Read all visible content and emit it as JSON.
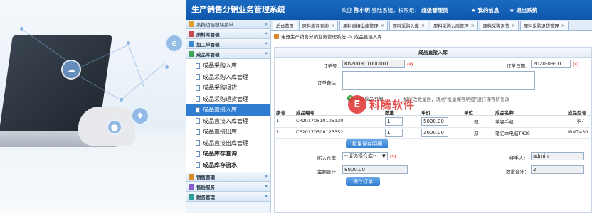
{
  "app": {
    "title": "生产销售分销业务管理系统",
    "welcome_prefix": "欢迎",
    "user": "陈小明",
    "welcome_mid": "登陆系统，权限组：",
    "role": "超级管理员",
    "my_info": "我的信息",
    "logout": "退出系统"
  },
  "sidebar": {
    "header": "系统功能模块菜单",
    "collapse_glyph": "«",
    "groups": [
      {
        "label": "原料库管理"
      },
      {
        "label": "加工单管理"
      },
      {
        "label": "成品库管理"
      }
    ],
    "items": [
      {
        "label": "成品采购入库"
      },
      {
        "label": "成品采购入库管理"
      },
      {
        "label": "成品采购退货"
      },
      {
        "label": "成品采购退货管理"
      },
      {
        "label": "成品直接入库"
      },
      {
        "label": "成品直接入库管理"
      },
      {
        "label": "成品直接出库"
      },
      {
        "label": "成品直接出库管理"
      },
      {
        "label": "成品库存查询"
      },
      {
        "label": "成品库存流水"
      }
    ],
    "bottom_groups": [
      {
        "label": "销售管理"
      },
      {
        "label": "售后服务"
      },
      {
        "label": "财务管理"
      }
    ]
  },
  "tabs": [
    {
      "label": "后台首页"
    },
    {
      "label": "原料库存查询"
    },
    {
      "label": "原料直接出库管理"
    },
    {
      "label": "原料采购入库"
    },
    {
      "label": "原料采购入库管理"
    },
    {
      "label": "原料采购退货"
    },
    {
      "label": "原料采购退货管理"
    }
  ],
  "breadcrumb": "电器生产销售分销业务管理系统 -> 成品直接入库",
  "form": {
    "title": "成品直接入库",
    "order_no_label": "订单号：",
    "order_no": "Kn200901000001",
    "req": "(*)",
    "order_date_label": "订单日期：",
    "order_date": "2020-09-01",
    "remark_label": "订单备注：",
    "add_detail": "添加成品明细",
    "hint": "如修改数量后，请点\"批量保存明细\"进行保存所修改",
    "columns": [
      "序号",
      "成品编号",
      "数量",
      "单价",
      "单位",
      "成品名称",
      "成品型号"
    ],
    "rows": [
      {
        "no": "1",
        "code": "CP20170510105130",
        "qty": "1",
        "price": "5000.00",
        "unit": "部",
        "name": "苹果手机",
        "model": "Ip7"
      },
      {
        "no": "2",
        "code": "CP20170506123352",
        "qty": "1",
        "price": "3000.00",
        "unit": "部",
        "name": "笔记本电脑T430",
        "model": "IBMT430"
      }
    ],
    "batch_save": "批量保存明细",
    "warehouse_label": "所入仓库：",
    "warehouse_value": "--请选择仓库--",
    "handler_label": "经手人：",
    "handler_value": "admin",
    "total_label": "金额合计：",
    "total_value": "8000.00",
    "qty_total_label": "数量合计：",
    "qty_total_value": "2",
    "save_order": "保存订单"
  },
  "watermark": {
    "logo": "E",
    "text": "科腾软件"
  },
  "colors": {
    "primary": "#1a6ac2",
    "active": "#2f7dd0",
    "required": "#dd0000",
    "watermark": "#e23c3c"
  }
}
